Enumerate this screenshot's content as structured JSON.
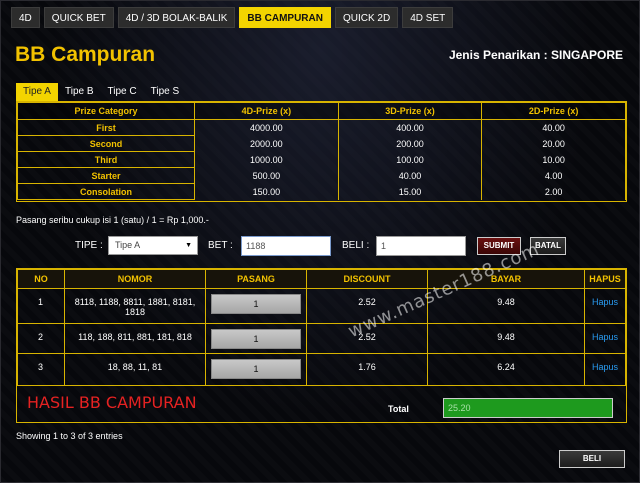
{
  "nav": {
    "tabs": [
      "4D",
      "QUICK BET",
      "4D / 3D BOLAK-BALIK",
      "BB CAMPURAN",
      "QUICK 2D",
      "4D SET"
    ],
    "active": "BB CAMPURAN"
  },
  "page": {
    "title": "BB Campuran",
    "jenis_penarikan": "Jenis Penarikan : SINGAPORE"
  },
  "tipe_tabs": [
    "Tipe A",
    "Tipe B",
    "Tipe C",
    "Tipe S"
  ],
  "prize_table": {
    "headers": [
      "Prize Category",
      "4D-Prize (x)",
      "3D-Prize (x)",
      "2D-Prize (x)"
    ],
    "rows": [
      [
        "First",
        "4000.00",
        "400.00",
        "40.00"
      ],
      [
        "Second",
        "2000.00",
        "200.00",
        "20.00"
      ],
      [
        "Third",
        "1000.00",
        "100.00",
        "10.00"
      ],
      [
        "Starter",
        "500.00",
        "40.00",
        "4.00"
      ],
      [
        "Consolation",
        "150.00",
        "15.00",
        "2.00"
      ]
    ]
  },
  "info_text": "Pasang seribu cukup isi 1 (satu) / 1 = Rp 1,000.-",
  "form": {
    "tipe_label": "TIPE :",
    "tipe_value": "Tipe A",
    "bet_label": "BET :",
    "bet_value": "1188",
    "beli_label": "BELI :",
    "beli_value": "1",
    "submit_label": "SUBMIT",
    "batal_label": "BATAL"
  },
  "bets_table": {
    "headers": [
      "NO",
      "NOMOR",
      "PASANG",
      "DISCOUNT",
      "BAYAR",
      "HAPUS"
    ],
    "rows": [
      {
        "no": "1",
        "nomor": "8118, 1188, 8811, 1881, 8181, 1818",
        "pasang": "1",
        "discount": "2.52",
        "bayar": "9.48",
        "hapus": "Hapus"
      },
      {
        "no": "2",
        "nomor": "118, 188, 811, 881, 181, 818",
        "pasang": "1",
        "discount": "2.52",
        "bayar": "9.48",
        "hapus": "Hapus"
      },
      {
        "no": "3",
        "nomor": "18, 88, 11, 81",
        "pasang": "1",
        "discount": "1.76",
        "bayar": "6.24",
        "hapus": "Hapus"
      }
    ],
    "hasil_label": "HASIL BB CAMPURAN",
    "total_label": "Total",
    "total_value": "25.20"
  },
  "showing": "Showing 1 to 3 of 3 entries",
  "beli_button": "BELI",
  "watermark": "www.master188.com",
  "colors": {
    "accent": "#f3d400",
    "gold": "#f2c200",
    "link": "#2a9df4",
    "total_bg": "#1e9a1e",
    "hasil": "#e52222"
  }
}
